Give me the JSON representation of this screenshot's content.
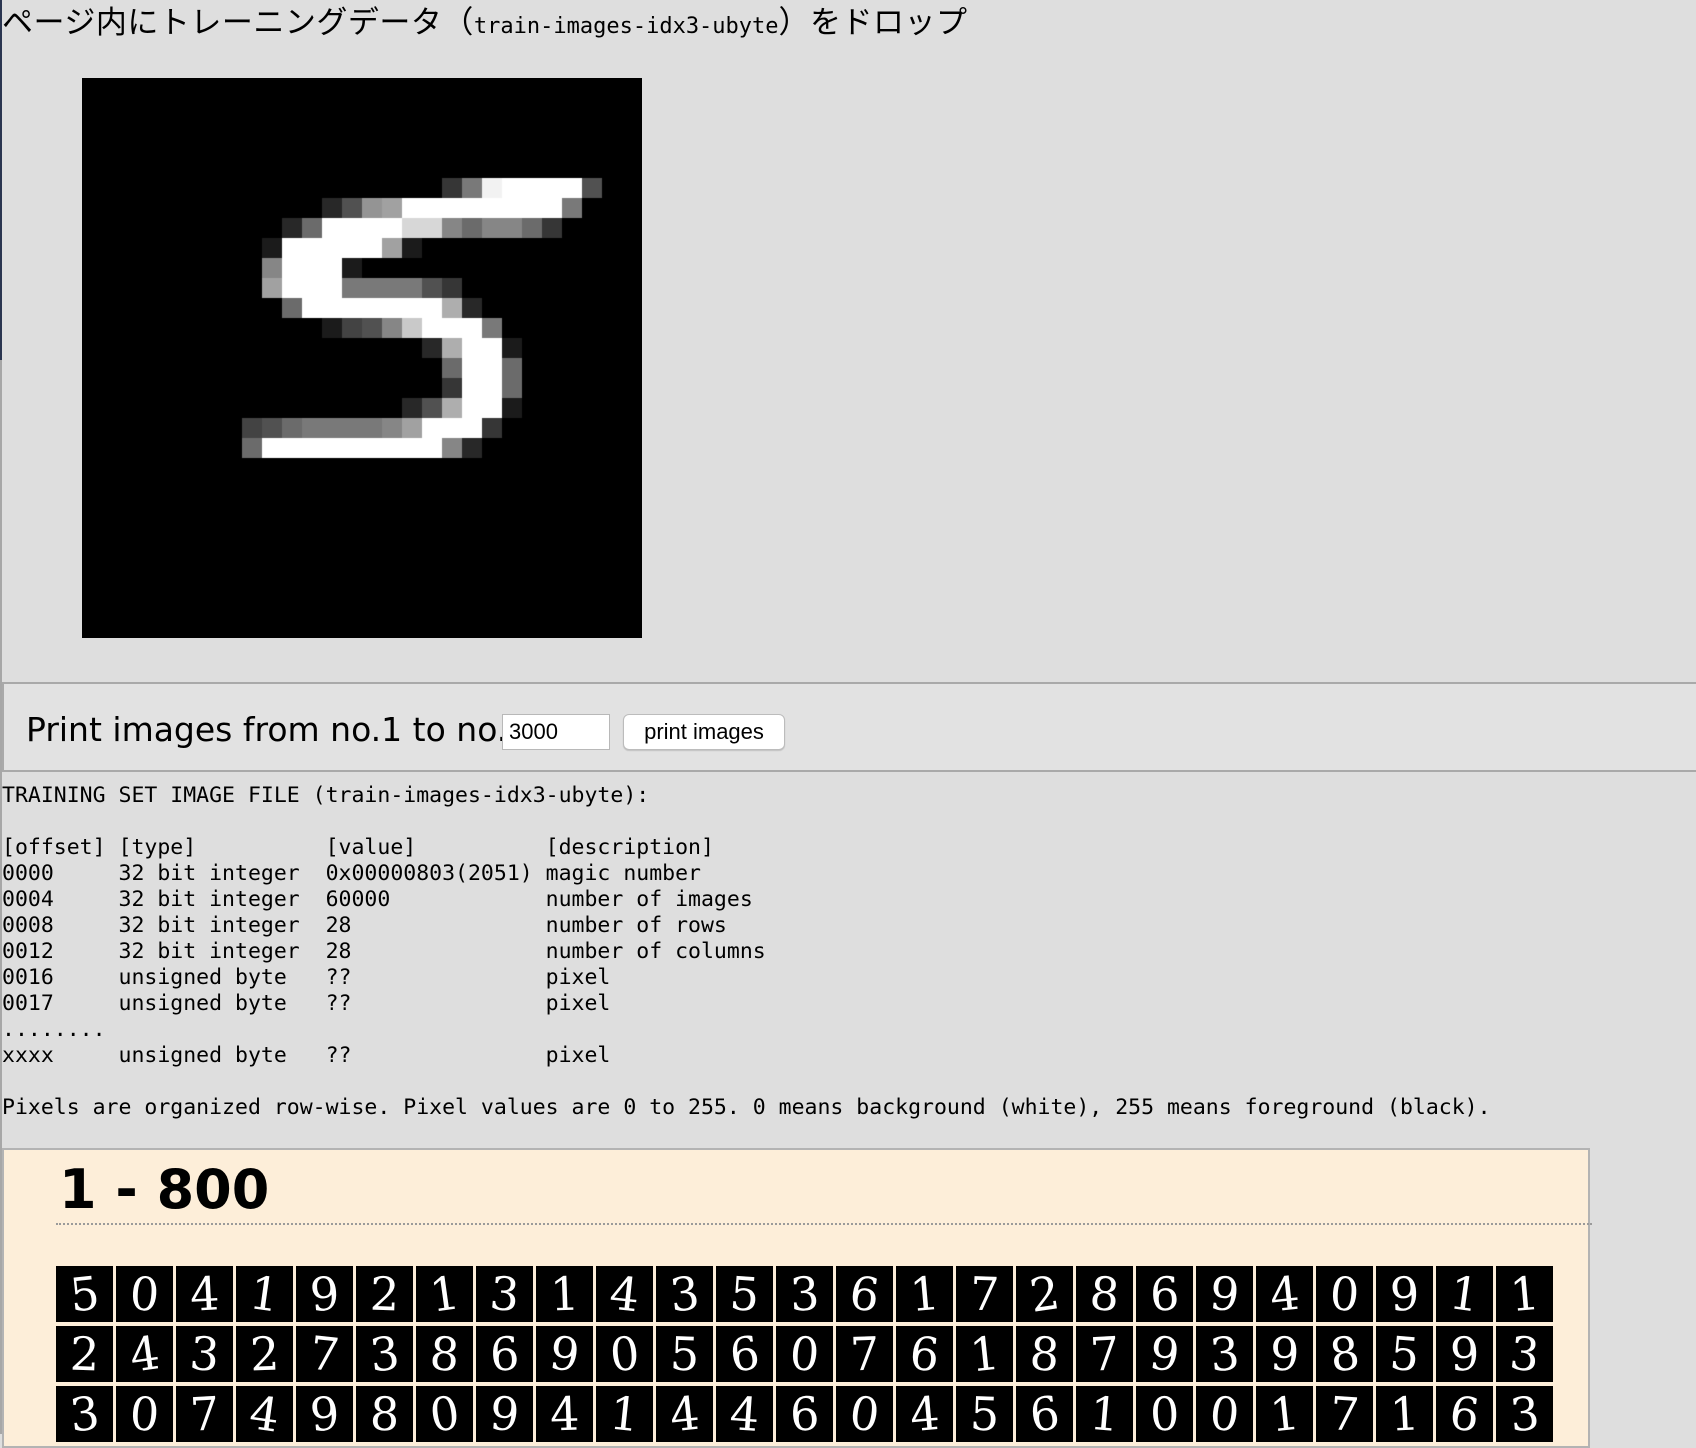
{
  "header": {
    "drop_prefix": "ページ内にトレーニングデータ（",
    "drop_file": "train-images-idx3-ubyte",
    "drop_suffix": "）をドロップ"
  },
  "preview": {
    "digit_label": "5",
    "pixel_rows": [
      "0000000000000000000000000000",
      "0000000000000000000000000000",
      "0000000000000000000000000000",
      "0000000000000000000000000000",
      "0000000000000000000000000000",
      "00000000000000000049IJJJJ600",
      "00000000000036BCJJJJJJJJ9000",
      "000000000038JJJJGGA8AA840000",
      "0000000002JJJJJC200000000000",
      "000000000AJJJ200000000000000",
      "000000000CJJJ999964000000000",
      "00000000008JJJJJJJD300000000",
      "000000000000256AFJJJ90000000",
      "000000000000000003DJJ2000000",
      "0000000000000000008JJ8000000",
      "0000000000000000004JJ8000000",
      "000000000000000036DJJ2000000",
      "000000005689999ACJJJ40000000",
      "000000008JJJJJJJJJA300000000",
      "0000000000000000000000000000",
      "0000000000000000000000000000",
      "0000000000000000000000000000",
      "0000000000000000000000000000",
      "0000000000000000000000000000",
      "0000000000000000000000000000",
      "0000000000000000000000000000",
      "0000000000000000000000000000",
      "0000000000000000000000000000"
    ]
  },
  "print_controls": {
    "label": "Print images from no.1 to no.",
    "input_value": "3000",
    "button_label": "print images"
  },
  "file_info": {
    "heading": "TRAINING SET IMAGE FILE (train-images-idx3-ubyte):",
    "columns": [
      "[offset]",
      "[type]",
      "[value]",
      "[description]"
    ],
    "rows": [
      [
        "0000",
        "32 bit integer",
        "0x00000803(2051)",
        "magic number"
      ],
      [
        "0004",
        "32 bit integer",
        "60000",
        "number of images"
      ],
      [
        "0008",
        "32 bit integer",
        "28",
        "number of rows"
      ],
      [
        "0012",
        "32 bit integer",
        "28",
        "number of columns"
      ],
      [
        "0016",
        "unsigned byte",
        "??",
        "pixel"
      ],
      [
        "0017",
        "unsigned byte",
        "??",
        "pixel"
      ]
    ],
    "ellipsis": "........",
    "last_row": [
      "xxxx",
      "unsigned byte",
      "??",
      "pixel"
    ],
    "note": "Pixels are organized row-wise. Pixel values are 0 to 255. 0 means background (white), 255 means foreground (black)."
  },
  "batch": {
    "title": "1 - 800",
    "digits": [
      "5",
      "0",
      "4",
      "1",
      "9",
      "2",
      "1",
      "3",
      "1",
      "4",
      "3",
      "5",
      "3",
      "6",
      "1",
      "7",
      "2",
      "8",
      "6",
      "9",
      "4",
      "0",
      "9",
      "1",
      "1",
      "2",
      "4",
      "3",
      "2",
      "7",
      "3",
      "8",
      "6",
      "9",
      "0",
      "5",
      "6",
      "0",
      "7",
      "6",
      "1",
      "8",
      "7",
      "9",
      "3",
      "9",
      "8",
      "5",
      "9",
      "3",
      "3",
      "0",
      "7",
      "4",
      "9",
      "8",
      "0",
      "9",
      "4",
      "1",
      "4",
      "4",
      "6",
      "0",
      "4",
      "5",
      "6",
      "1",
      "0",
      "0",
      "1",
      "7",
      "1",
      "6",
      "3"
    ]
  }
}
